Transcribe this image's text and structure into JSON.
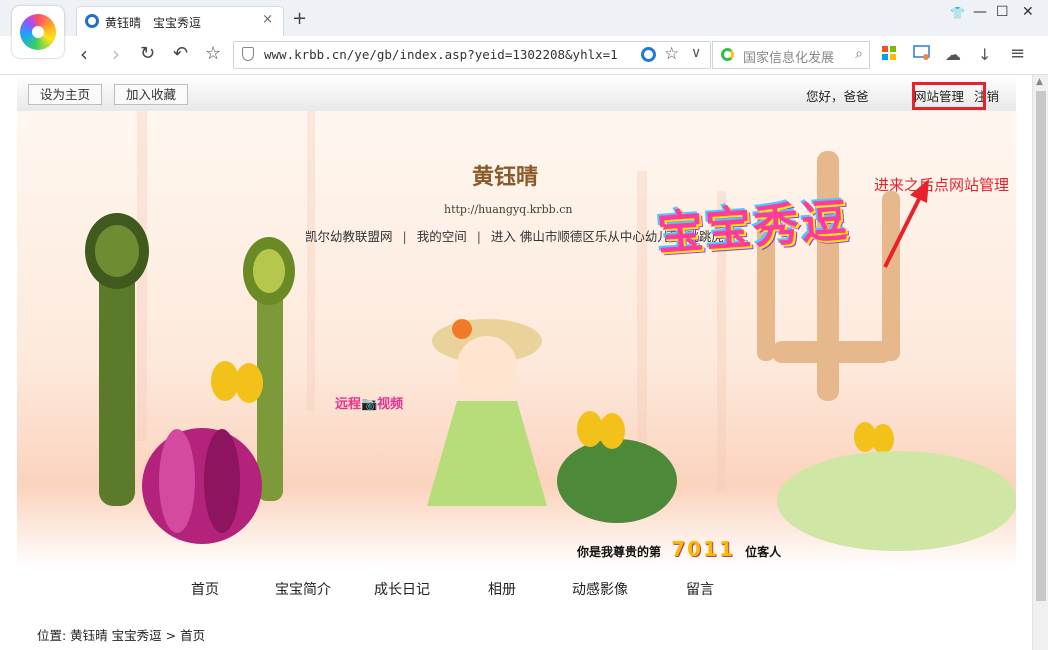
{
  "browser": {
    "tab_title": "黄钰晴　宝宝秀逗",
    "tab_close": "×",
    "new_tab": "+",
    "url": "www.krbb.cn/ye/gb/index.asp?yeid=1302208&yhlx=1",
    "search_placeholder": "国家信息化发展",
    "window_controls": {
      "skin": "👕",
      "minimize": "—",
      "maximize": "☐",
      "close": "✕"
    }
  },
  "site": {
    "topbar": {
      "set_home": "设为主页",
      "add_favorite": "加入收藏",
      "greeting": "您好，爸爸",
      "site_manage": "网站管理",
      "logout": "注销"
    },
    "baby_name": "黄钰晴",
    "site_url": "http://huangyq.krbb.cn",
    "sub_links": [
      "凯尔幼教联盟网",
      "我的空间",
      "进入 佛山市顺德区乐从中心幼儿园 跳跳虎班"
    ],
    "sub_link_sep": "|",
    "show_title": "宝宝秀逗",
    "video_label": "远程📷视频",
    "visitor_prefix": "你是我尊贵的第",
    "visitor_count": "7011",
    "visitor_suffix": "位客人",
    "nav": [
      "首页",
      "宝宝简介",
      "成长日记",
      "相册",
      "动感影像",
      "留言"
    ],
    "breadcrumb": "位置: 黄钰晴 宝宝秀逗 > 首页"
  },
  "annotation": {
    "text": "进来之后点网站管理",
    "color": "#e8222b"
  },
  "colors": {
    "accent_red": "#e8222b",
    "banner_bg": "#fde9dc"
  }
}
